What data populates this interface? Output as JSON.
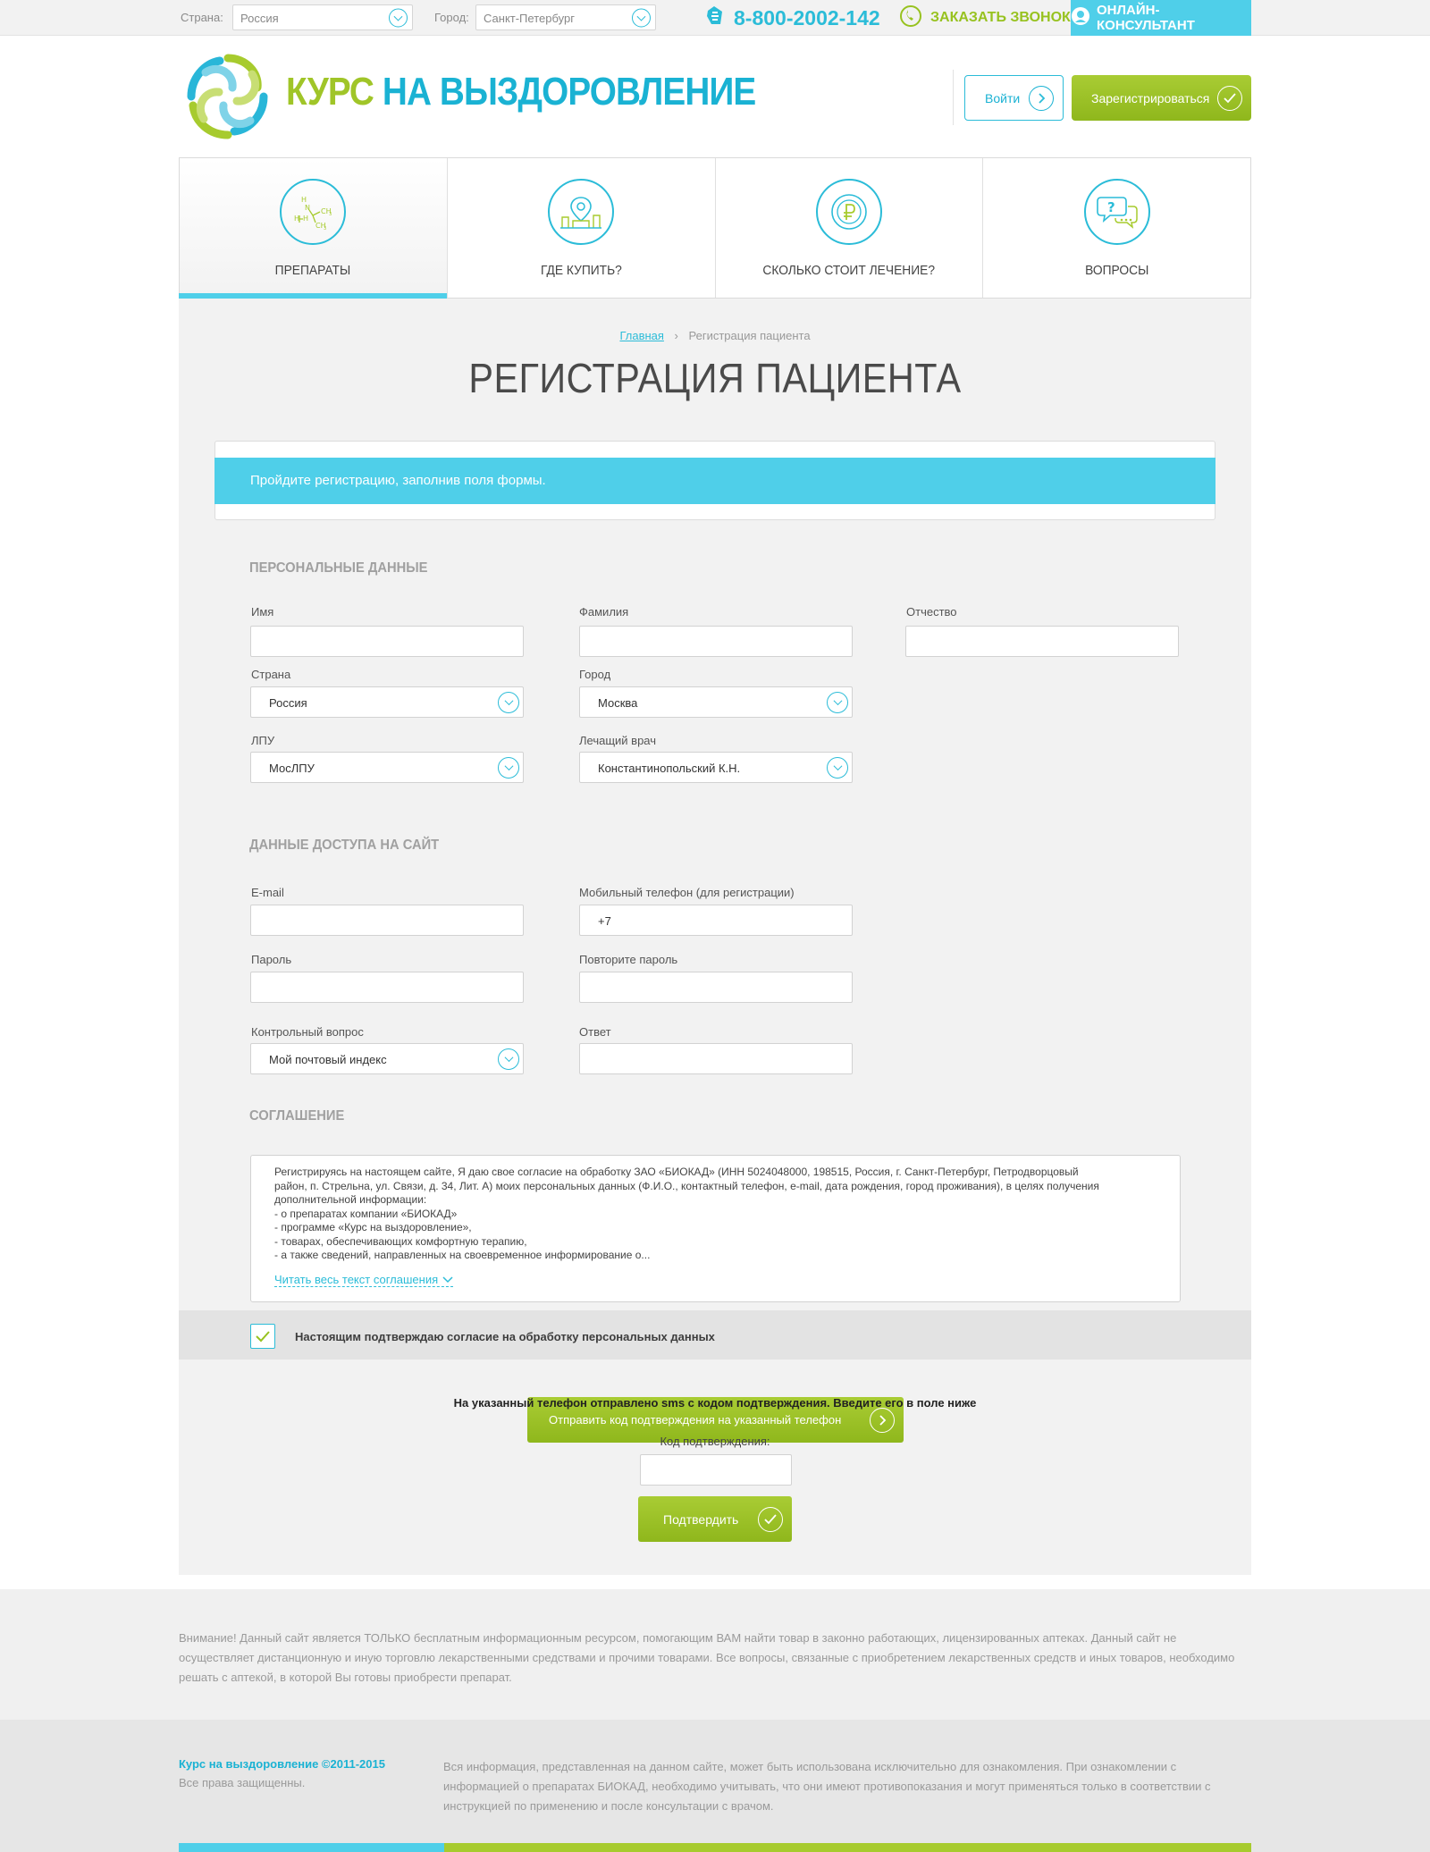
{
  "topbar": {
    "country_label": "Страна:",
    "country_value": "Россия",
    "city_label": "Город:",
    "city_value": "Санкт-Петербург",
    "phone": "8-800-2002-142",
    "call_label": "ЗАКАЗАТЬ ЗВОНОК",
    "consult_label": "ОНЛАЙН-КОНСУЛЬТАНТ"
  },
  "header": {
    "logo_part1": "КУРС",
    "logo_part2": "НА ВЫЗДОРОВЛЕНИЕ",
    "login_label": "Войти",
    "register_label": "Зарегистрироваться"
  },
  "nav": {
    "items": [
      {
        "label": "ПРЕПАРАТЫ"
      },
      {
        "label": "ГДЕ КУПИТЬ?"
      },
      {
        "label": "СКОЛЬКО СТОИТ ЛЕЧЕНИЕ?"
      },
      {
        "label": "ВОПРОСЫ"
      }
    ]
  },
  "breadcrumb": {
    "home": "Главная",
    "separator": "›",
    "current": "Регистрация пациента"
  },
  "page": {
    "title": "РЕГИСТРАЦИЯ ПАЦИЕНТА",
    "notice": "Пройдите регистрацию, заполнив поля формы."
  },
  "personal": {
    "title": "ПЕРСОНАЛЬНЫЕ ДАННЫЕ",
    "first_name_label": "Имя",
    "last_name_label": "Фамилия",
    "patronymic_label": "Отчество",
    "country_label": "Страна",
    "country_value": "Россия",
    "city_label": "Город",
    "city_value": "Москва",
    "lpu_label": "ЛПУ",
    "lpu_value": "МосЛПУ",
    "doctor_label": "Лечащий врач",
    "doctor_value": "Константинопольский К.Н."
  },
  "access": {
    "title": "ДАННЫЕ ДОСТУПА НА САЙТ",
    "email_label": "E-mail",
    "phone_label": "Мобильный телефон (для  регистрации)",
    "phone_value": "+7",
    "password_label": "Пароль",
    "password_repeat_label": "Повторите пароль",
    "question_label": "Контрольный вопрос",
    "question_value": "Мой почтовый индекс",
    "answer_label": "Ответ"
  },
  "agreement": {
    "title": "СОГЛАШЕНИЕ",
    "lines": [
      "Регистрируясь на настоящем сайте, Я даю свое согласие на обработку ЗАО «БИОКАД» (ИНН 5024048000, 198515, Россия, г. Санкт-Петербург, Петродворцовый",
      "район, п. Стрельна, ул. Связи, д. 34, Лит. А) моих персональных данных (Ф.И.О., контактный телефон, e-mail, дата рождения, город проживания), в целях получения",
      "дополнительной информации:",
      "- о препаратах компании «БИОКАД»",
      "- программе «Курс на выздоровление»,",
      "- товарах, обеспечивающих комфортную терапию,",
      "- а также сведений, направленных на своевременное информирование о..."
    ],
    "read_more": "Читать весь текст соглашения",
    "consent": "Настоящим подтверждаю согласие на обработку персональных данных"
  },
  "verify": {
    "send_label": "Отправить код подтверждения на указанный телефон",
    "sms_notice": "На указанный телефон отправлено sms с кодом подтверждения. Введите его в поле ниже",
    "code_label": "Код подтверждения:",
    "confirm_label": "Подтвердить"
  },
  "footer": {
    "warning": "Внимание! Данный сайт является ТОЛЬКО бесплатным информационным ресурсом, помогающим ВАМ найти товар в законно работающих, лицензированных аптеках. Данный сайт не осуществляет дистанционную и иную торговлю лекарственными средствами и прочими товарами. Все вопросы, связанные с приобретением лекарственных средств и иных товаров, необходимо решать с аптекой, в которой Вы готовы приобрести препарат.",
    "copyright": "Курс на выздоровление ©2011-2015",
    "rights": "Все права защищенны.",
    "info": "Вся информация, представленная на данном сайте, может быть использована исключительно для ознакомления. При ознакомлении с информацией о препаратах БИОКАД, необходимо учитывать, что они имеют противопоказания и могут применяться только в соответствии с инструкцией по применению и после консультации с врачом."
  },
  "colors": {
    "accent_blue": "#4fcfe9",
    "accent_green": "#97c21f"
  }
}
